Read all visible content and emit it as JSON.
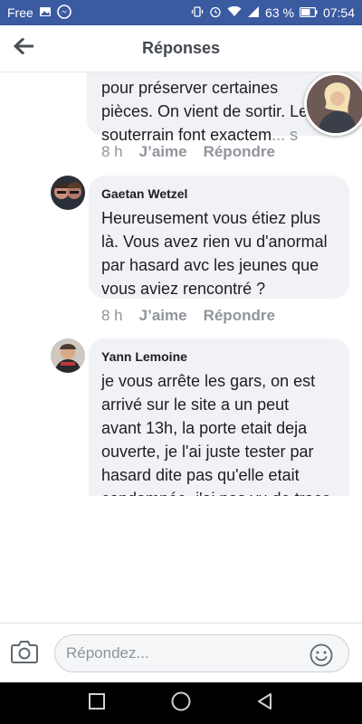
{
  "status_bar": {
    "carrier": "Free",
    "battery_percent": "63 %",
    "time": "07:54"
  },
  "header": {
    "title": "Réponses",
    "back_icon": "arrow-left-icon"
  },
  "comments": [
    {
      "author": "",
      "text_lines": [
        "pour préserver certaines",
        "pièces. On vient de sortir. Le",
        "souterrain font exactem"
      ],
      "see_more": "... s",
      "time": "8 h",
      "like_label": "J’aime",
      "reply_label": "Répondre"
    },
    {
      "author": "Gaetan Wetzel",
      "text_lines": [
        "Heureusement vous étiez plus",
        "là. Vous avez rien vu d'anormal",
        "par hasard avc les jeunes que",
        "vous aviez rencontré ?"
      ],
      "time": "8 h",
      "like_label": "J’aime",
      "reply_label": "Répondre"
    },
    {
      "author": "Yann Lemoine",
      "text_lines": [
        "je vous arrête les gars, on est",
        "arrivé sur le site a un peut",
        "avant 13h, la porte etait deja",
        "ouverte, je l'ai juste tester par",
        "hasard dite pas qu'elle etait",
        "condamnée, j'ai pas vu de trace"
      ]
    }
  ],
  "composer": {
    "placeholder": "Répondez...",
    "camera_icon": "camera-icon",
    "emoji_icon": "smiley-icon"
  },
  "nav": {
    "items": [
      "recents-square-icon",
      "home-circle-icon",
      "back-triangle-icon"
    ]
  },
  "colors": {
    "status_bar_bg": "#3b5ba0",
    "bubble_bg": "#f0f2f5",
    "secondary_text": "#90949c",
    "nav_bar_bg": "#000000"
  }
}
